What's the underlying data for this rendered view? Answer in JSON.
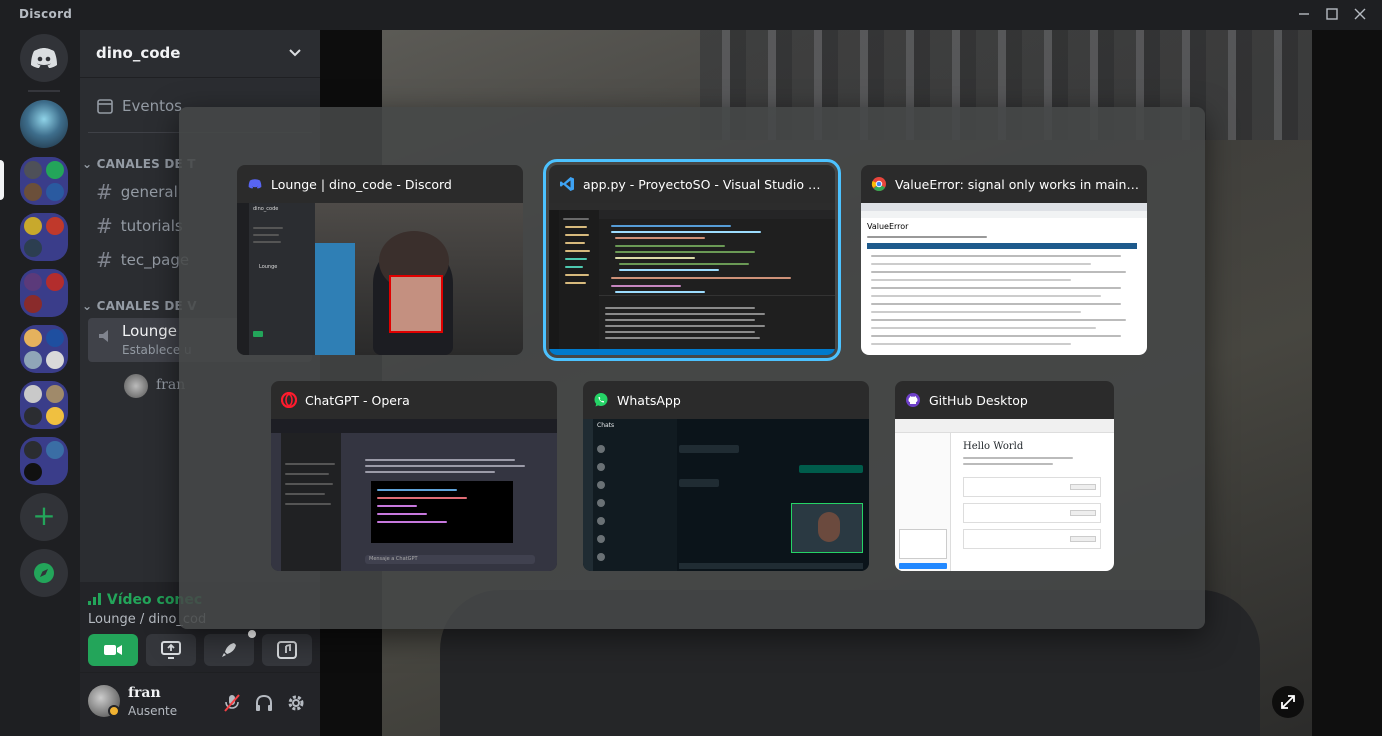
{
  "window": {
    "title": "Discord",
    "minimize": "—",
    "maximize": "☐",
    "close": "✕"
  },
  "guilds": {
    "home_icon": "discord-logo-icon",
    "add_server": "+",
    "explore": "compass-icon"
  },
  "sidebar": {
    "server_name": "dino_code",
    "events_label": "Eventos",
    "text_category": "CANALES DE T",
    "text_channels": [
      "general",
      "tutorials",
      "tec_page"
    ],
    "voice_category": "CANALES DE V",
    "voice_channel": "Lounge",
    "voice_channel_sub": "Establece u",
    "voice_member": "fran"
  },
  "voice_panel": {
    "status": "Vídeo conec",
    "location": "Lounge / dino_cod"
  },
  "user_panel": {
    "username": "fran",
    "status": "Ausente"
  },
  "task_switcher": {
    "windows": [
      {
        "title": "Lounge | dino_code - Discord",
        "icon": "discord-icon",
        "icon_color": "#5865f2"
      },
      {
        "title": "app.py - ProyectoSO - Visual Studio Code",
        "icon": "vscode-icon",
        "icon_color": "#3ea3f4",
        "selected": true
      },
      {
        "title": "ValueError: signal only works in main threa…",
        "icon": "chrome-icon",
        "icon_color": "#e8453c"
      },
      {
        "title": "ChatGPT - Opera",
        "icon": "opera-icon",
        "icon_color": "#ff1b2d"
      },
      {
        "title": "WhatsApp",
        "icon": "whatsapp-icon",
        "icon_color": "#25d366"
      },
      {
        "title": "GitHub Desktop",
        "icon": "github-desktop-icon",
        "icon_color": "#6e40c9"
      }
    ],
    "thumb_texts": {
      "chrome_heading": "ValueError",
      "discord_server": "dino_code",
      "discord_channel": "Lounge",
      "whatsapp_header": "Chats",
      "opera_prompt": "Mensaje a ChatGPT",
      "github_heading": "Hello World"
    }
  },
  "colors": {
    "accent_green": "#23a55a",
    "blurple": "#5865f2",
    "selection": "#4cc2ff"
  }
}
